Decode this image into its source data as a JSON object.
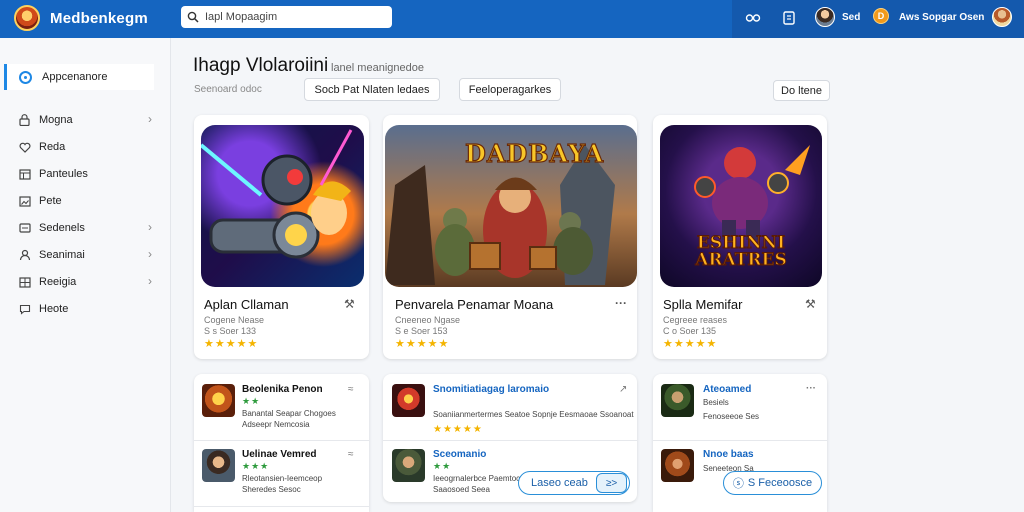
{
  "app": {
    "brand": "Medbenkegm"
  },
  "search": {
    "value": "Iapl Mopaagim"
  },
  "topbar": {
    "icon1": "C̶q",
    "user1_name": "Sed",
    "coin_label": "D",
    "user2_name": "Aws Sopgar Osen"
  },
  "sidebar": {
    "active": "Appcenanore",
    "items": [
      {
        "label": "Mogna",
        "icon": "lock-icon",
        "chevron": true
      },
      {
        "label": "Reda",
        "icon": "heart-icon",
        "chevron": false
      },
      {
        "label": "Panteules",
        "icon": "grid-icon",
        "chevron": false
      },
      {
        "label": "Pete",
        "icon": "image-icon",
        "chevron": false
      },
      {
        "label": "Sedenels",
        "icon": "card-icon",
        "chevron": true
      },
      {
        "label": "Seanimai",
        "icon": "user-icon",
        "chevron": true
      },
      {
        "label": "Reeigia",
        "icon": "table-icon",
        "chevron": true
      },
      {
        "label": "Heote",
        "icon": "chat-icon",
        "chevron": false
      }
    ]
  },
  "header": {
    "title": "Ihagp Vlolaroiini",
    "subtitle": "lanel meanignedoe",
    "meta": "Seenoard odoc",
    "chips": [
      "Socb Pat Nlaten ledaes",
      "Feeloperagarkes",
      "Do ltene"
    ]
  },
  "featured": [
    {
      "title": "Aplan Cllaman",
      "sub1": "Cogene Nease",
      "sub2": "S s Soer 133",
      "stars": "★★★★★",
      "action": "⚒"
    },
    {
      "title": "Penvarela Penamar Moana",
      "sub1": "Cneeneo Ngase",
      "sub2": "S e Soer 153",
      "stars": "★★★★★",
      "action": "···"
    },
    {
      "title": "Splla Memifar",
      "sub1": "Cegreee reases",
      "sub2": "C o Soer 135",
      "stars": "★★★★★",
      "action": "⚒"
    }
  ],
  "featured_art_texts": {
    "card2_logo": "DADBAYA",
    "card3_logo": "ESHINNI ARATRES"
  },
  "lists": [
    {
      "items": [
        {
          "title": "Beolenika Penon",
          "stars": "★★",
          "desc1": "Banantal Seapar Chogoes",
          "desc2": "Adseepr Nemcosia",
          "action": "≈"
        },
        {
          "title": "Uelinae Vemred",
          "stars": "★★★",
          "desc1": "Rleotansien-Ieemceop",
          "desc2": "Sheredes Sesoc",
          "action": "≈"
        }
      ]
    },
    {
      "items": [
        {
          "title": "Snomitiatiagag laromaio",
          "stars": "★★★★★",
          "desc1": "Soaniianmertermes Seatoe Sopnje Eesmaoae Ssoanoat",
          "desc2": "",
          "action": "↗"
        },
        {
          "title": "Sceomanio",
          "stars": "★★",
          "desc1": "Ieeogrnalerbce Paemtoc",
          "desc2": "Saaosoed Seea",
          "action": ""
        }
      ],
      "pill": "Laseo ceab",
      "pill_arrow": "≥>"
    },
    {
      "items": [
        {
          "title": "Ateoamed",
          "stars": "",
          "desc1": "Besiels",
          "desc2": "Fenoseeoe Ses",
          "action": "···"
        },
        {
          "title": "Nnoe baas",
          "stars": "",
          "desc1": "Seneeteon Sa",
          "desc2": "",
          "action": ""
        }
      ],
      "pill": "S Feceoosce",
      "pill_icon": "ⓢ"
    }
  ],
  "colors": {
    "topbar": "#1565c0",
    "accent": "#1e88e5",
    "star": "#f4b400",
    "green_star": "#2e9b3d"
  }
}
